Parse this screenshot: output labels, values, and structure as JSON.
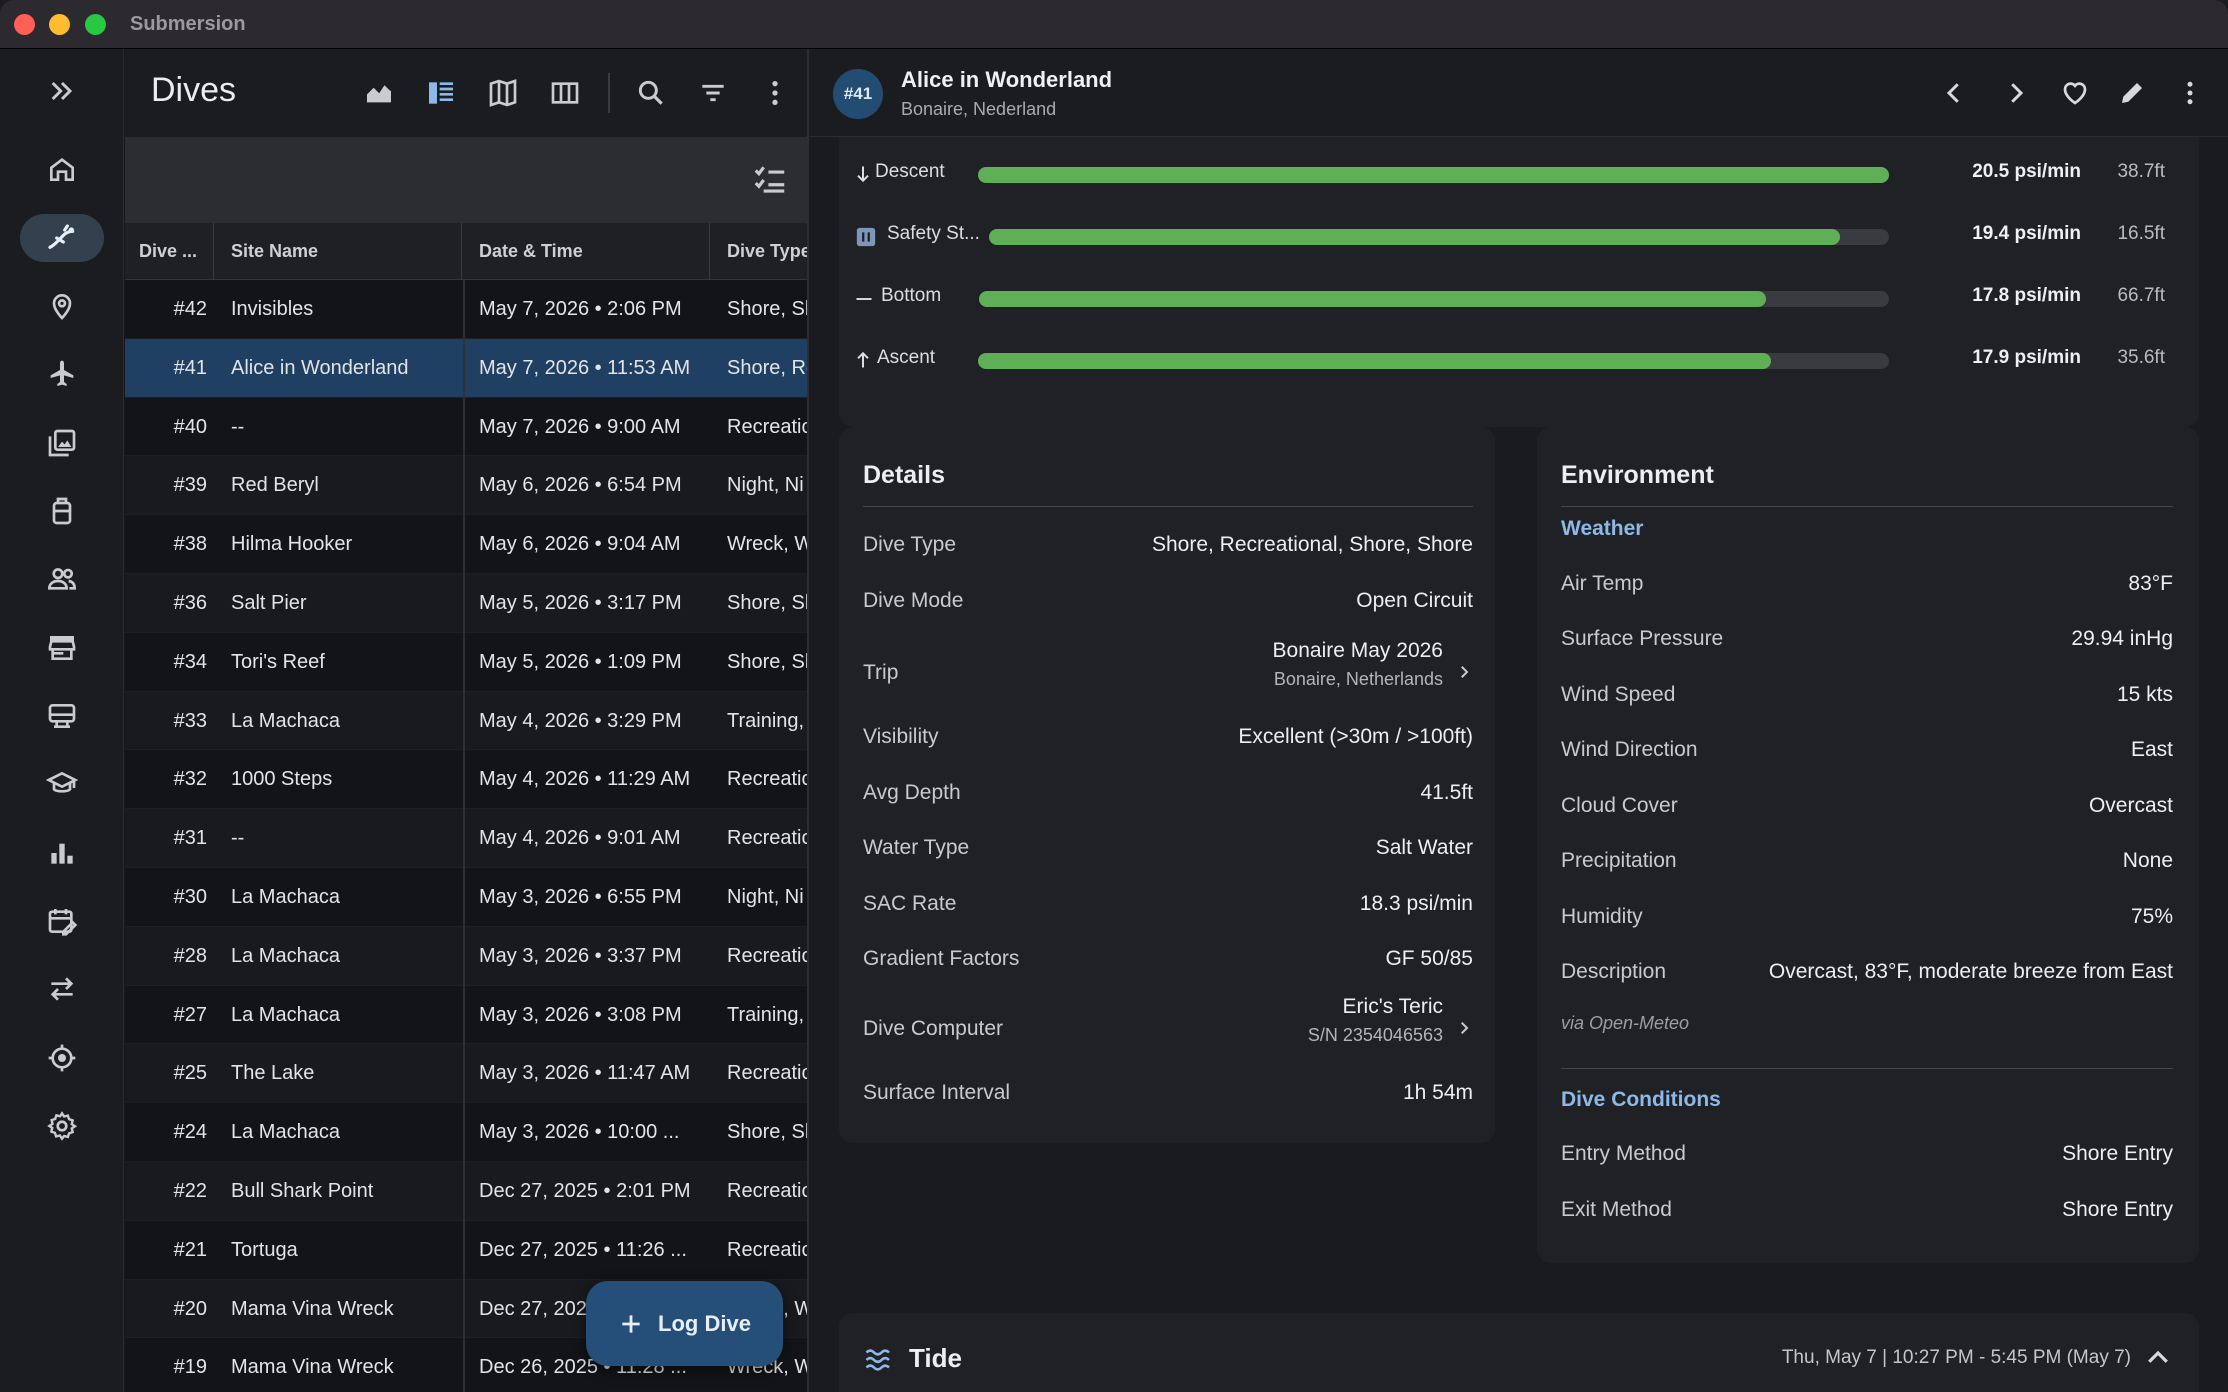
{
  "window": {
    "title": "Submersion"
  },
  "rail": {
    "items": [
      {
        "name": "expand-rail",
        "icon": "double-chevron-right-icon"
      },
      {
        "name": "home",
        "icon": "home-icon"
      },
      {
        "name": "dives",
        "icon": "diver-icon",
        "active": true
      },
      {
        "name": "sites",
        "icon": "map-pin-icon"
      },
      {
        "name": "trips",
        "icon": "airplane-icon"
      },
      {
        "name": "media",
        "icon": "photo-library-icon"
      },
      {
        "name": "equipment",
        "icon": "tank-icon"
      },
      {
        "name": "buddies",
        "icon": "people-icon"
      },
      {
        "name": "dive-centers",
        "icon": "store-icon"
      },
      {
        "name": "computers",
        "icon": "dive-computer-icon"
      },
      {
        "name": "certifications",
        "icon": "graduation-cap-icon"
      },
      {
        "name": "statistics",
        "icon": "bar-chart-icon"
      },
      {
        "name": "planner",
        "icon": "calendar-edit-icon"
      },
      {
        "name": "transfer",
        "icon": "swap-arrows-icon"
      },
      {
        "name": "gps",
        "icon": "target-icon"
      },
      {
        "name": "settings",
        "icon": "gear-icon"
      }
    ]
  },
  "list": {
    "title": "Dives",
    "columns": [
      "Dive ...",
      "Site Name",
      "Date & Time",
      "Dive Type"
    ],
    "rows": [
      {
        "num": "#42",
        "site": "Invisibles",
        "date": "May 7, 2026 • 2:06 PM",
        "type": "Shore, Sh"
      },
      {
        "num": "#41",
        "site": "Alice in Wonderland",
        "date": "May 7, 2026 • 11:53 AM",
        "type": "Shore, Re",
        "selected": true
      },
      {
        "num": "#40",
        "site": "--",
        "date": "May 7, 2026 • 9:00 AM",
        "type": "Recreational"
      },
      {
        "num": "#39",
        "site": "Red Beryl",
        "date": "May 6, 2026 • 6:54 PM",
        "type": "Night, Ni"
      },
      {
        "num": "#38",
        "site": "Hilma Hooker",
        "date": "May 6, 2026 • 9:04 AM",
        "type": "Wreck, W"
      },
      {
        "num": "#36",
        "site": "Salt Pier",
        "date": "May 5, 2026 • 3:17 PM",
        "type": "Shore, Sh"
      },
      {
        "num": "#34",
        "site": "Tori's Reef",
        "date": "May 5, 2026 • 1:09 PM",
        "type": "Shore, Sh"
      },
      {
        "num": "#33",
        "site": "La Machaca",
        "date": "May 4, 2026 • 3:29 PM",
        "type": "Training,"
      },
      {
        "num": "#32",
        "site": "1000 Steps",
        "date": "May 4, 2026 • 11:29 AM",
        "type": "Recreational"
      },
      {
        "num": "#31",
        "site": "--",
        "date": "May 4, 2026 • 9:01 AM",
        "type": "Recreational"
      },
      {
        "num": "#30",
        "site": "La Machaca",
        "date": "May 3, 2026 • 6:55 PM",
        "type": "Night, Ni"
      },
      {
        "num": "#28",
        "site": "La Machaca",
        "date": "May 3, 2026 • 3:37 PM",
        "type": "Recreational"
      },
      {
        "num": "#27",
        "site": "La Machaca",
        "date": "May 3, 2026 • 3:08 PM",
        "type": "Training,"
      },
      {
        "num": "#25",
        "site": "The Lake",
        "date": "May 3, 2026 • 11:47 AM",
        "type": "Recreational"
      },
      {
        "num": "#24",
        "site": "La Machaca",
        "date": "May 3, 2026 • 10:00 ...",
        "type": "Shore, Sh"
      },
      {
        "num": "#22",
        "site": "Bull Shark Point",
        "date": "Dec 27, 2025 • 2:01 PM",
        "type": "Recreational"
      },
      {
        "num": "#21",
        "site": "Tortuga",
        "date": "Dec 27, 2025 • 11:26 ...",
        "type": "Recreational"
      },
      {
        "num": "#20",
        "site": "Mama Vina Wreck",
        "date": "Dec 27, 2025 • 10:03 ...",
        "type": "Wreck, W"
      },
      {
        "num": "#19",
        "site": "Mama Vina Wreck",
        "date": "Dec 26, 2025 • 11:28 ...",
        "type": "Wreck, W"
      }
    ],
    "fab_label": "Log Dive"
  },
  "detail": {
    "badge": "#41",
    "title": "Alice in Wonderland",
    "subtitle": "Bonaire, Nederland",
    "rates": [
      {
        "label": "Descent",
        "icon": "arrow-down-icon",
        "value": "20.5 psi/min",
        "depth": "38.7ft",
        "fill": 1.0
      },
      {
        "label": "Safety St...",
        "icon": "pause-icon",
        "value": "19.4 psi/min",
        "depth": "16.5ft",
        "fill": 0.945
      },
      {
        "label": "Bottom",
        "icon": "dash-icon",
        "value": "17.8 psi/min",
        "depth": "66.7ft",
        "fill": 0.865
      },
      {
        "label": "Ascent",
        "icon": "arrow-up-icon",
        "value": "17.9 psi/min",
        "depth": "35.6ft",
        "fill": 0.87
      }
    ],
    "details": {
      "title": "Details",
      "dive_type_k": "Dive Type",
      "dive_type_v": "Shore, Recreational, Shore, Shore",
      "dive_mode_k": "Dive Mode",
      "dive_mode_v": "Open Circuit",
      "trip_k": "Trip",
      "trip_v": "Bonaire May 2026",
      "trip_sub": "Bonaire, Netherlands",
      "visibility_k": "Visibility",
      "visibility_v": "Excellent (>30m / >100ft)",
      "avg_depth_k": "Avg Depth",
      "avg_depth_v": "41.5ft",
      "water_type_k": "Water Type",
      "water_type_v": "Salt Water",
      "sac_k": "SAC Rate",
      "sac_v": "18.3 psi/min",
      "gf_k": "Gradient Factors",
      "gf_v": "GF 50/85",
      "computer_k": "Dive Computer",
      "computer_v": "Eric's Teric",
      "computer_sub": "S/N 2354046563",
      "interval_k": "Surface Interval",
      "interval_v": "1h 54m"
    },
    "environment": {
      "title": "Environment",
      "weather_head": "Weather",
      "air_temp_k": "Air Temp",
      "air_temp_v": "83°F",
      "pressure_k": "Surface Pressure",
      "pressure_v": "29.94 inHg",
      "wind_speed_k": "Wind Speed",
      "wind_speed_v": "15 kts",
      "wind_dir_k": "Wind Direction",
      "wind_dir_v": "East",
      "cloud_k": "Cloud Cover",
      "cloud_v": "Overcast",
      "precip_k": "Precipitation",
      "precip_v": "None",
      "humidity_k": "Humidity",
      "humidity_v": "75%",
      "desc_k": "Description",
      "desc_v": "Overcast, 83°F, moderate breeze from East",
      "via": "via Open-Meteo",
      "conditions_head": "Dive Conditions",
      "entry_k": "Entry Method",
      "entry_v": "Shore Entry",
      "exit_k": "Exit Method",
      "exit_v": "Shore Entry"
    },
    "tide": {
      "title": "Tide",
      "range": "Thu, May 7 | 10:27 PM - 5:45 PM (May 7)"
    }
  },
  "colors": {
    "accent": "#8db9e8",
    "selection": "#1f3f63",
    "progress": "#5faf57",
    "fab": "#254f78"
  }
}
